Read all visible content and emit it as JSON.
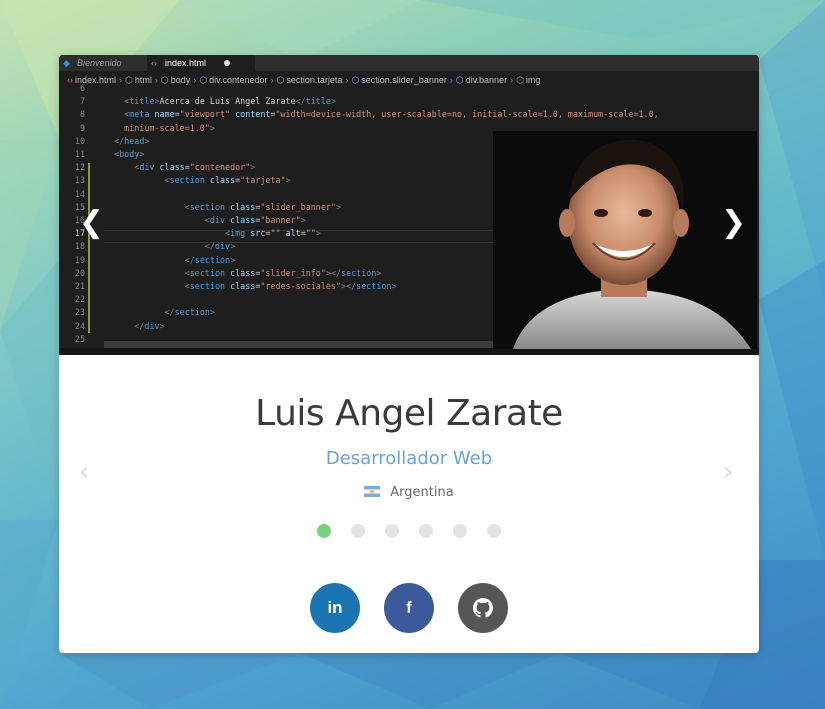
{
  "editor": {
    "tabs": [
      {
        "label": "Bienvenido",
        "icon": "vscode-icon"
      },
      {
        "label": "index.html",
        "icon": "html-icon"
      }
    ],
    "breadcrumb": [
      "index.html",
      "html",
      "body",
      "div.contenedor",
      "section.tarjeta",
      "section.slider_banner",
      "div.banner",
      "img"
    ],
    "lines": [
      {
        "n": "6",
        "html": ""
      },
      {
        "n": "7",
        "html": "    <span class='t-punc'>&lt;</span><span class='t-tag'>title</span><span class='t-punc'>&gt;</span>Acerca de Luis Angel Zarate<span class='t-punc'>&lt;/</span><span class='t-tag'>title</span><span class='t-punc'>&gt;</span>"
      },
      {
        "n": "8",
        "html": "    <span class='t-punc'>&lt;</span><span class='t-tag'>meta</span> <span class='t-attr'>name</span>=<span class='t-str'>\"viewport\"</span> <span class='t-attr'>content</span>=<span class='t-str'>\"width=device-width, user-scalable=no, initial-scale=1.0, maximum-scale=1.0,</span>"
      },
      {
        "n": "9",
        "html": "    <span class='t-str'>minium-scale=1.0\"</span><span class='t-punc'>&gt;</span>"
      },
      {
        "n": "10",
        "html": "  <span class='t-punc'>&lt;/</span><span class='t-tag'>head</span><span class='t-punc'>&gt;</span>"
      },
      {
        "n": "11",
        "html": "  <span class='t-punc'>&lt;</span><span class='t-tag'>body</span><span class='t-punc'>&gt;</span>"
      },
      {
        "n": "12",
        "html": "      <span class='t-punc'>&lt;</span><span class='t-tag'>div</span> <span class='t-attr'>class</span>=<span class='t-str'>\"contenedor\"</span><span class='t-punc'>&gt;</span>"
      },
      {
        "n": "13",
        "html": "            <span class='t-punc'>&lt;</span><span class='t-tag'>section</span> <span class='t-attr'>class</span>=<span class='t-str'>\"tarjeta\"</span><span class='t-punc'>&gt;</span>"
      },
      {
        "n": "14",
        "html": ""
      },
      {
        "n": "15",
        "html": "                <span class='t-punc'>&lt;</span><span class='t-tag'>section</span> <span class='t-attr'>class</span>=<span class='t-str'>\"slider_banner\"</span><span class='t-punc'>&gt;</span>"
      },
      {
        "n": "16",
        "html": "                    <span class='t-punc'>&lt;</span><span class='t-tag'>div</span> <span class='t-attr'>class</span>=<span class='t-str'>\"banner\"</span><span class='t-punc'>&gt;</span>"
      },
      {
        "n": "17",
        "html": "                        <span class='t-punc'>&lt;</span><span class='t-tag'>img</span> <span class='t-attr'>src</span>=<span class='t-str'>\"\"</span> <span class='t-attr'>alt</span>=<span class='t-str'>\"\"</span><span class='t-punc'>&gt;</span>"
      },
      {
        "n": "18",
        "html": "                    <span class='t-punc'>&lt;/</span><span class='t-tag'>div</span><span class='t-punc'>&gt;</span>"
      },
      {
        "n": "19",
        "html": "                <span class='t-punc'>&lt;/</span><span class='t-tag'>section</span><span class='t-punc'>&gt;</span>"
      },
      {
        "n": "20",
        "html": "                <span class='t-punc'>&lt;</span><span class='t-tag'>section</span> <span class='t-attr'>class</span>=<span class='t-str'>\"slider_info\"</span><span class='t-punc'>&gt;&lt;/</span><span class='t-tag'>section</span><span class='t-punc'>&gt;</span>"
      },
      {
        "n": "21",
        "html": "                <span class='t-punc'>&lt;</span><span class='t-tag'>section</span> <span class='t-attr'>class</span>=<span class='t-str'>\"redes-sociales\"</span><span class='t-punc'>&gt;&lt;/</span><span class='t-tag'>section</span><span class='t-punc'>&gt;</span>"
      },
      {
        "n": "22",
        "html": ""
      },
      {
        "n": "23",
        "html": "            <span class='t-punc'>&lt;/</span><span class='t-tag'>section</span><span class='t-punc'>&gt;</span>"
      },
      {
        "n": "24",
        "html": "      <span class='t-punc'>&lt;/</span><span class='t-tag'>div</span><span class='t-punc'>&gt;</span>"
      },
      {
        "n": "25",
        "html": ""
      }
    ],
    "current_line": "17"
  },
  "slider": {
    "prev_arrow": "‹",
    "next_arrow": "›",
    "dot_count": 6,
    "active_dot": 0,
    "dot_active_color": "#7bd17b"
  },
  "profile": {
    "name": "Luis Angel Zarate",
    "role": "Desarrollador Web",
    "country": "Argentina"
  },
  "social": [
    {
      "name": "linkedin",
      "label": "in",
      "color": "#1b75b3"
    },
    {
      "name": "facebook",
      "label": "f",
      "color": "#3c5a9a"
    },
    {
      "name": "github",
      "label": "github",
      "color": "#565656"
    }
  ]
}
